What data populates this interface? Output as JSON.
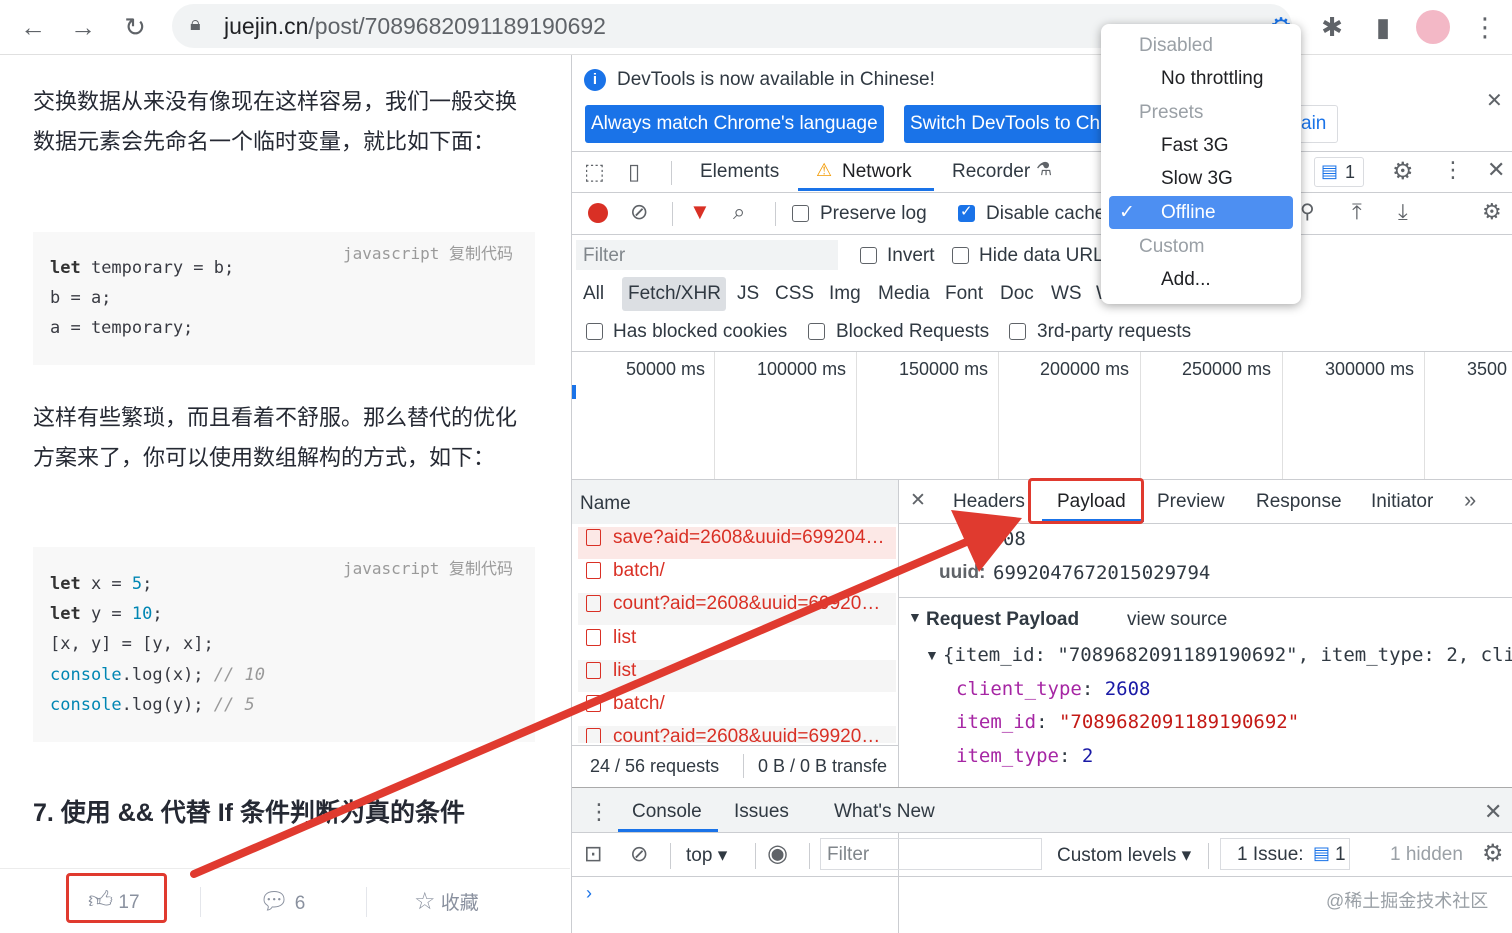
{
  "browser": {
    "url_host": "juejin.cn",
    "url_path": "/post/7089682091189190692"
  },
  "article": {
    "para1": "交换数据从来没有像现在这样容易，我们一般交换数据元素会先命名一个临时变量，就比如下面：",
    "code1": {
      "lang": "javascript",
      "copy": "复制代码",
      "lines": [
        "let temporary = b;",
        "b = a;",
        "a = temporary;"
      ]
    },
    "para2": "这样有些繁琐，而且看着不舒服。那么替代的优化方案来了，你可以使用数组解构的方式，如下：",
    "code2": {
      "lang": "javascript",
      "copy": "复制代码",
      "l1_kw": "let",
      "l1_rest": " x = ",
      "l1_num": "5",
      "l1_end": ";",
      "l2_kw": "let",
      "l2_rest": " y = ",
      "l2_num": "10",
      "l2_end": ";",
      "l3": "[x, y] = [y, x];",
      "l4_fn": "console",
      "l4_rest": ".log(x); ",
      "l4_cmt": "// 10",
      "l5_fn": "console",
      "l5_rest": ".log(y); ",
      "l5_cmt": "// 5"
    },
    "heading": "7. 使用 && 代替 If 条件判断为真的条件",
    "likes": "17",
    "comments": "6",
    "collect": "收藏"
  },
  "devtools": {
    "info_banner": "DevTools is now available in Chinese!",
    "btn_match_lang": "Always match Chrome's language",
    "btn_switch": "Switch DevTools to Ch",
    "btn_again": "ain",
    "tabs": {
      "elements": "Elements",
      "network": "Network",
      "recorder": "Recorder"
    },
    "issues_count": "1",
    "preserve_log": "Preserve log",
    "disable_cache": "Disable cache",
    "filter_placeholder": "Filter",
    "invert": "Invert",
    "hide_data_urls": "Hide data URL",
    "type_filters": [
      "All",
      "Fetch/XHR",
      "JS",
      "CSS",
      "Img",
      "Media",
      "Font",
      "Doc",
      "WS",
      "W"
    ],
    "has_blocked_cookies": "Has blocked cookies",
    "blocked_requests": "Blocked Requests",
    "third_party": "3rd-party requests",
    "timeline_ticks": [
      "50000 ms",
      "100000 ms",
      "150000 ms",
      "200000 ms",
      "250000 ms",
      "300000 ms",
      "3500"
    ],
    "name_header": "Name",
    "requests": [
      "save?aid=2608&uuid=699204…",
      "batch/",
      "count?aid=2608&uuid=69920…",
      "list",
      "list",
      "batch/",
      "count?aid=2608&uuid=69920…"
    ],
    "footer_requests": "24 / 56 requests",
    "footer_transfer": "0 B / 0 B transfe",
    "detail_tabs": {
      "headers": "Headers",
      "payload": "Payload",
      "preview": "Preview",
      "response": "Response",
      "initiator": "Initiator"
    },
    "param_aid_value": "2608",
    "param_uuid_key": "uuid:",
    "param_uuid_value": "6992047672015029794",
    "request_payload": "Request Payload",
    "view_source": "view source",
    "payload_summary": "{item_id: \"7089682091189190692\", item_type: 2, cli",
    "payload_rows": [
      {
        "key": "client_type",
        "value": "2608"
      },
      {
        "key": "item_id",
        "value": "\"7089682091189190692\""
      },
      {
        "key": "item_type",
        "value": "2"
      }
    ],
    "drawer_tabs": {
      "console": "Console",
      "issues": "Issues",
      "whats_new": "What's New"
    },
    "context": "top",
    "console_filter": "Filter",
    "custom_levels": "Custom levels",
    "issue_label": "1 Issue:",
    "issue_count": "1",
    "hidden": "1 hidden",
    "watermark": "@稀土掘金技术社区"
  },
  "throttle_menu": {
    "disabled": "Disabled",
    "no_throttling": "No throttling",
    "presets": "Presets",
    "fast3g": "Fast 3G",
    "slow3g": "Slow 3G",
    "offline": "Offline",
    "custom": "Custom",
    "add": "Add..."
  },
  "colors": {
    "annotation_red": "#e03a2f",
    "devtools_blue": "#1a73e8",
    "request_red": "#d93025"
  }
}
